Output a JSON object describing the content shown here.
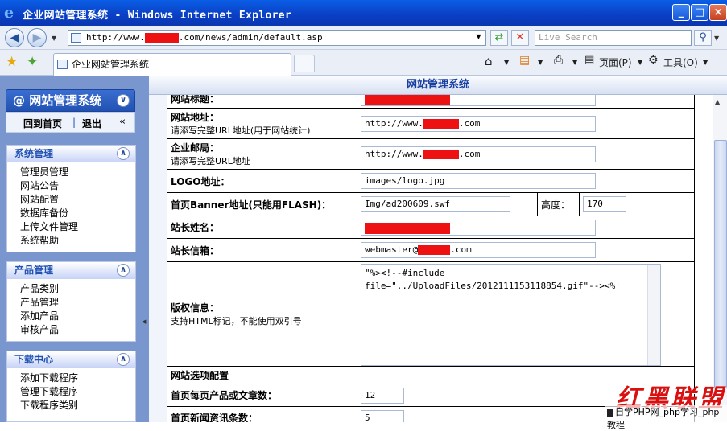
{
  "window": {
    "title": "企业网站管理系统 - Windows Internet Explorer",
    "minimize": "_",
    "maximize": "□",
    "close": "×"
  },
  "address": {
    "prefix": "http://www.",
    "suffix": ".com/news/admin/default.asp"
  },
  "search": {
    "placeholder": "Live Search"
  },
  "tab": {
    "label": "企业网站管理系统"
  },
  "toolbar": {
    "page": "页面(P)",
    "tools": "工具(O)"
  },
  "sidebar": {
    "title": "网站管理系统",
    "home_link": "回到首页",
    "separator": "|",
    "logout_link": "退出",
    "panels": [
      {
        "title": "系统管理",
        "items": [
          "管理员管理",
          "网站公告",
          "网站配置",
          "数据库备份",
          "上传文件管理",
          "系统帮助"
        ]
      },
      {
        "title": "产品管理",
        "items": [
          "产品类别",
          "产品管理",
          "添加产品",
          "审核产品"
        ]
      },
      {
        "title": "下载中心",
        "items": [
          "添加下载程序",
          "管理下载程序",
          "下载程序类别"
        ]
      }
    ]
  },
  "header": {
    "title": "网站管理系统"
  },
  "form": {
    "site_title_label": "网站标题：",
    "site_url_label": "网站地址：",
    "site_url_hint": "请添写完整URL地址(用于网站统计)",
    "site_url_prefix": "http://www.",
    "site_url_suffix": ".com",
    "corp_mail_label": "企业邮局：",
    "corp_mail_hint": "请添写完整URL地址",
    "corp_mail_prefix": "http://www.",
    "corp_mail_suffix": ".com",
    "logo_label": "LOGO地址：",
    "logo_value": "images/logo.jpg",
    "banner_label": "首页Banner地址(只能用FLASH)：",
    "banner_value": "Img/ad200609.swf",
    "height_label": "高度：",
    "height_value": "170",
    "owner_label": "站长姓名：",
    "owner_email_label": "站长信箱：",
    "owner_email_prefix": "webmaster@",
    "owner_email_suffix": ".com",
    "copyright_label": "版权信息：",
    "copyright_hint": "支持HTML标记，不能使用双引号",
    "copyright_line1": "\"%><!--#include",
    "copyright_line2": "file=\"../UploadFiles/2012111153118854.gif\"--><%'",
    "options_section": "网站选项配置",
    "products_per_page_label": "首页每页产品或文章数：",
    "products_per_page_value": "12",
    "news_count_label": "首页新闻资讯条数：",
    "news_count_value": "5"
  },
  "watermark": {
    "brand": "红黑联盟",
    "caption": "自学PHP网_php学习_php教程"
  }
}
